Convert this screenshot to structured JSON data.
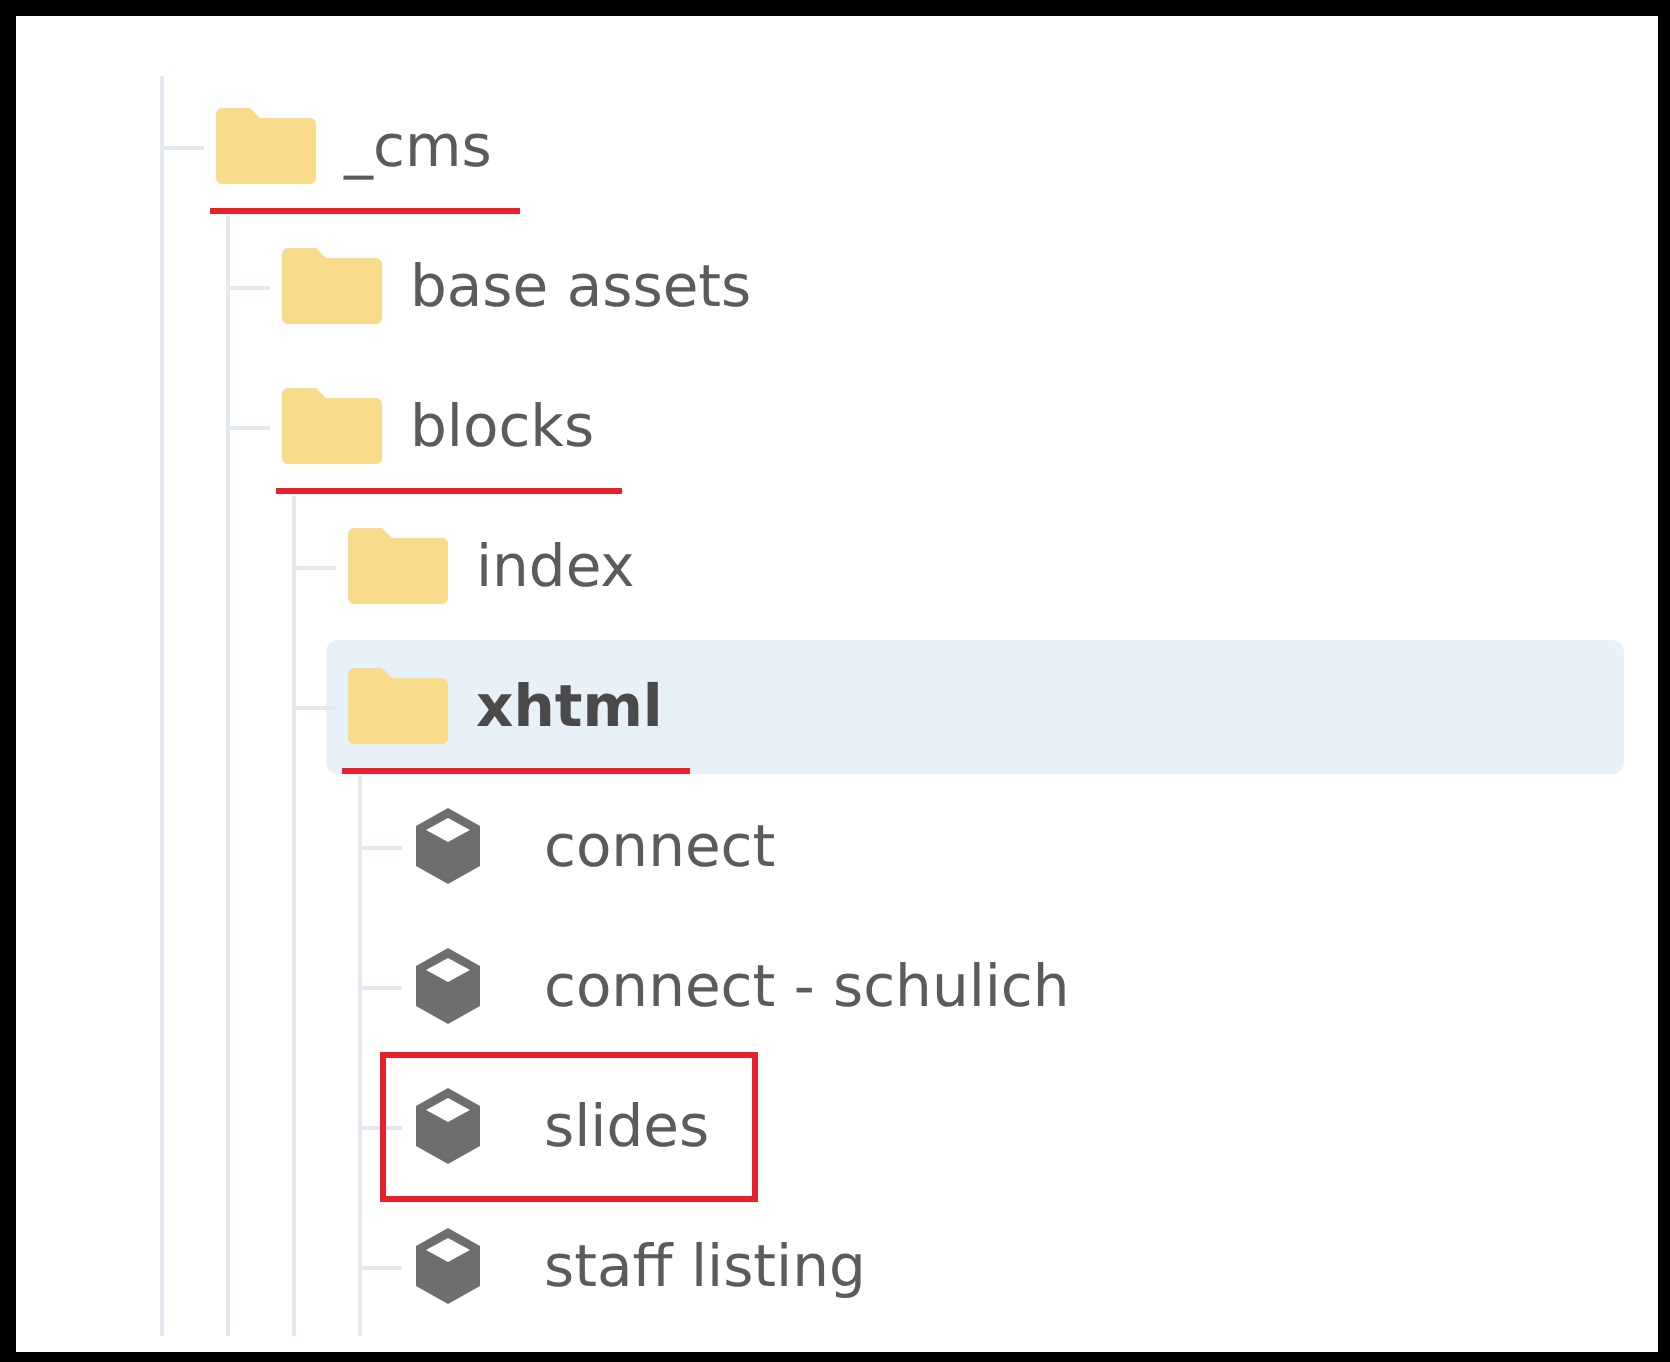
{
  "tree": [
    {
      "label": "_cms",
      "kind": "folder",
      "selected": false,
      "underlined": true,
      "boxed": false,
      "children": [
        {
          "label": "base assets",
          "kind": "folder",
          "selected": false,
          "underlined": false,
          "boxed": false
        },
        {
          "label": "blocks",
          "kind": "folder",
          "selected": false,
          "underlined": true,
          "boxed": false,
          "children": [
            {
              "label": "index",
              "kind": "folder",
              "selected": false,
              "underlined": false,
              "boxed": false
            },
            {
              "label": "xhtml",
              "kind": "folder",
              "selected": true,
              "underlined": true,
              "boxed": false,
              "children": [
                {
                  "label": "connect",
                  "kind": "block",
                  "selected": false,
                  "underlined": false,
                  "boxed": false
                },
                {
                  "label": "connect - schulich",
                  "kind": "block",
                  "selected": false,
                  "underlined": false,
                  "boxed": false
                },
                {
                  "label": "slides",
                  "kind": "block",
                  "selected": false,
                  "underlined": false,
                  "boxed": true
                },
                {
                  "label": "staff listing",
                  "kind": "block",
                  "selected": false,
                  "underlined": false,
                  "boxed": false
                }
              ]
            }
          ]
        }
      ]
    }
  ]
}
